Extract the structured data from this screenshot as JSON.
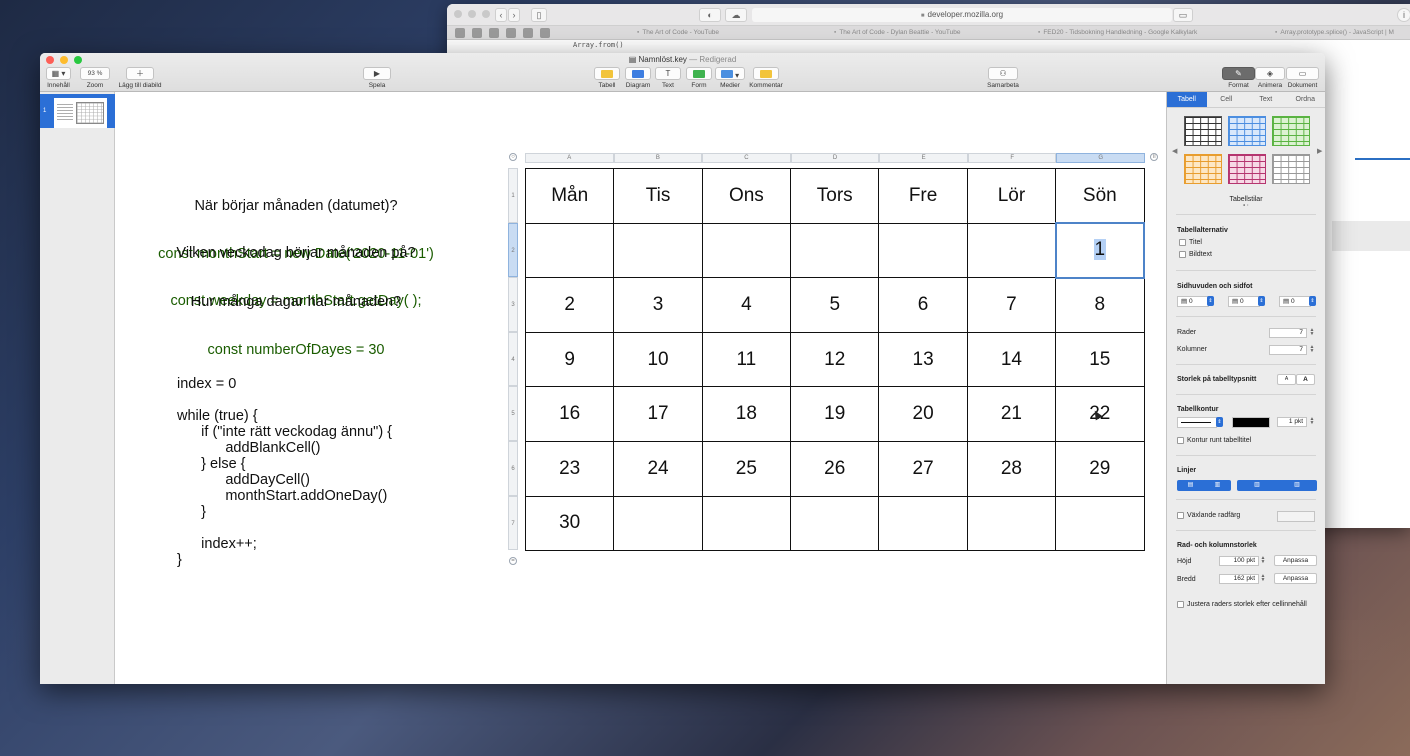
{
  "safari": {
    "url": "developer.mozilla.org",
    "tabs": [
      "The Art of Code - YouTube",
      "The Art of Code - Dylan Beattie - YouTube",
      "FED20 - Tidsbokning Handledning - Google Kalkylark",
      "Array.prototype.splice() - JavaScript | M"
    ],
    "code_snippet": "Array.from()"
  },
  "keynote": {
    "file_name": "Namnlöst.key",
    "status": "— Redigerad",
    "toolbar": {
      "view": "Innehåll",
      "zoom_value": "93 %",
      "zoom": "Zoom",
      "add_slide": "Lägg till diabild",
      "play": "Spela",
      "table": "Tabell",
      "chart": "Diagram",
      "text": "Text",
      "shape": "Form",
      "media": "Medier",
      "comment": "Kommentar",
      "collaborate": "Samarbeta",
      "format": "Format",
      "animate": "Animera",
      "document": "Dokument"
    },
    "navigator": {
      "slide_number": "1"
    },
    "slide": {
      "block1_line1": "När börjar månaden (datumet)?",
      "block1_line2": "const monthStart = new Date('2020-11-01')",
      "block2_line1": "Vilken veckodag börjar månaden på?",
      "block2_line2": "const weekday = monthStart.getDay( );",
      "block3_line1": "Hur många dagar har månaden?",
      "block3_line2": "const numberOfDayes = 30",
      "code": "index = 0\n\nwhile (true) {\n      if (\"inte rätt veckodag ännu\") {\n            addBlankCell()\n      } else {\n            addDayCell()\n            monthStart.addOneDay()\n      }\n\n      index++;\n}",
      "column_letters": [
        "A",
        "B",
        "C",
        "D",
        "E",
        "F",
        "G"
      ],
      "row_numbers": [
        "1",
        "2",
        "3",
        "4",
        "5",
        "6",
        "7"
      ],
      "table": [
        [
          "Mån",
          "Tis",
          "Ons",
          "Tors",
          "Fre",
          "Lör",
          "Sön"
        ],
        [
          "",
          "",
          "",
          "",
          "",
          "",
          "1"
        ],
        [
          "2",
          "3",
          "4",
          "5",
          "6",
          "7",
          "8"
        ],
        [
          "9",
          "10",
          "11",
          "12",
          "13",
          "14",
          "15"
        ],
        [
          "16",
          "17",
          "18",
          "19",
          "20",
          "21",
          "22"
        ],
        [
          "23",
          "24",
          "25",
          "26",
          "27",
          "28",
          "29"
        ],
        [
          "30",
          "",
          "",
          "",
          "",
          "",
          ""
        ]
      ]
    },
    "inspector": {
      "tabs": [
        "Tabell",
        "Cell",
        "Text",
        "Ordna"
      ],
      "active_tab": "Tabell",
      "styles_label": "Tabellstilar",
      "table_options": "Tabellalternativ",
      "title": "Titel",
      "caption": "Bildtext",
      "headers_footer": "Sidhuvuden och sidfot",
      "hf_values": [
        "0",
        "0",
        "0"
      ],
      "rows_label": "Rader",
      "rows_value": "7",
      "columns_label": "Kolumner",
      "columns_value": "7",
      "font_size_label": "Storlek på tabelltypsnitt",
      "font_small": "A",
      "font_large": "A",
      "outline_label": "Tabellkontur",
      "outline_value": "1 pkt",
      "outline_title": "Kontur runt tabelltitel",
      "lines_label": "Linjer",
      "alternating": "Växlande radfärg",
      "row_col_size": "Rad- och kolumnstorlek",
      "height_label": "Höjd",
      "height_value": "100 pkt",
      "width_label": "Bredd",
      "width_value": "162 pkt",
      "fit": "Anpassa",
      "adjust_rows": "Justera raders storlek efter cellinnehåll"
    }
  }
}
